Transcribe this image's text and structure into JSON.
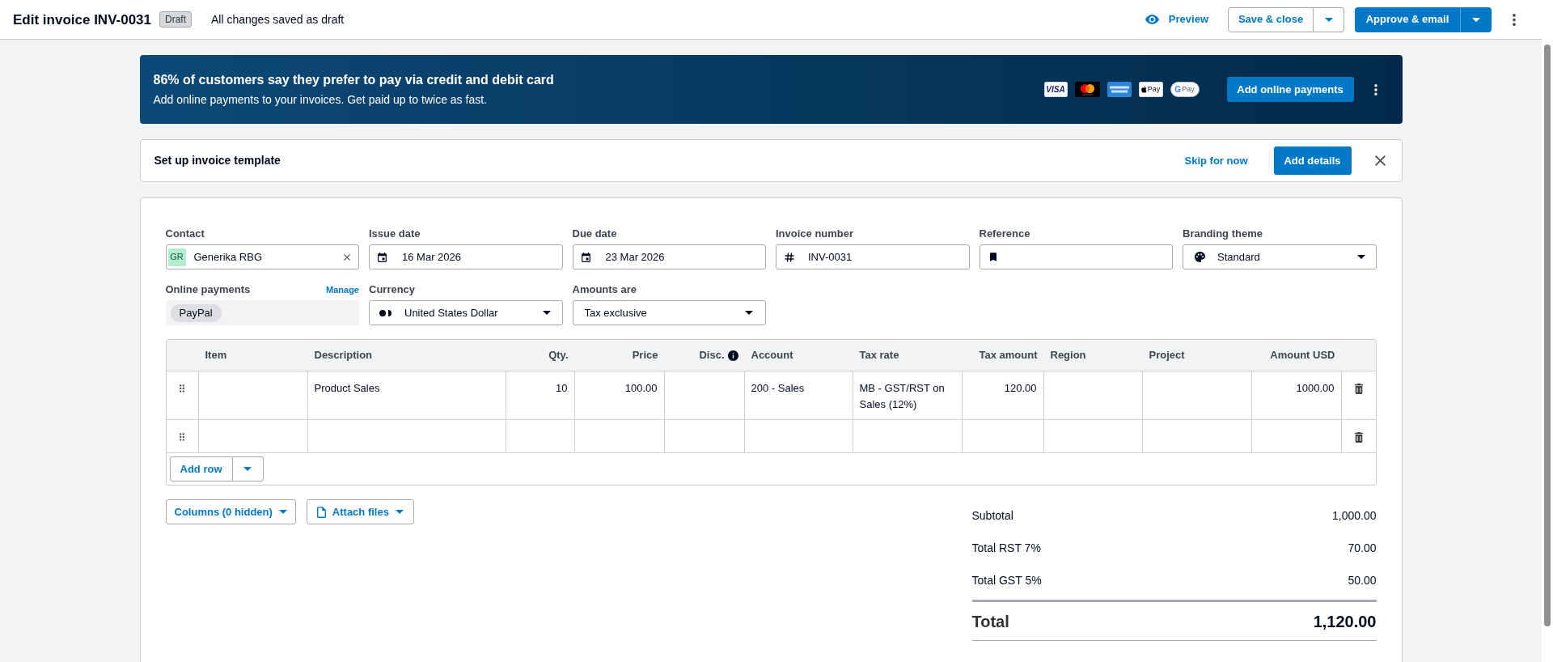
{
  "header": {
    "title": "Edit invoice INV-0031",
    "status": "Draft",
    "save_state": "All changes saved as draft",
    "preview": "Preview",
    "save": "Save & close",
    "approve": "Approve & email"
  },
  "promo_banner": {
    "title": "86% of customers say they prefer to pay via credit and debit card",
    "text": "Add online payments to your invoices. Get paid up to twice as fast.",
    "payment_logos": [
      {
        "kind": "visa",
        "label": "VISA"
      },
      {
        "kind": "mastercard"
      },
      {
        "kind": "amex"
      },
      {
        "kind": "applepay",
        "label": "Pay"
      },
      {
        "kind": "gpay",
        "mark": "G",
        "label": "Pay"
      }
    ],
    "button": "Add online payments"
  },
  "template_bar": {
    "title": "Set up invoice template",
    "link": "Skip for now",
    "button": "Add details"
  },
  "fields": [
    {
      "kind": "contact",
      "label": "Contact",
      "initials": "GR",
      "value": "Generika RBG"
    },
    {
      "kind": "date",
      "label": "Issue date",
      "value": "16 Mar 2026"
    },
    {
      "kind": "date",
      "label": "Due date",
      "value": "23 Mar 2026"
    },
    {
      "kind": "invoice_number",
      "label": "Invoice number",
      "value": "INV-0031"
    },
    {
      "kind": "reference",
      "label": "Reference"
    },
    {
      "kind": "theme",
      "label": "Branding theme",
      "value": "Standard"
    },
    {
      "kind": "payments",
      "label": "Online payments",
      "link": "Manage",
      "chips": [
        "PayPal"
      ]
    },
    {
      "kind": "currency",
      "label": "Currency",
      "value": "United States Dollar"
    },
    {
      "kind": "select",
      "label": "Amounts are",
      "value": "Tax exclusive"
    }
  ],
  "line_items": {
    "columns": [
      {
        "label": "Item",
        "kind": "text",
        "info": false
      },
      {
        "label": "Description",
        "kind": "text",
        "info": false
      },
      {
        "label": "Qty.",
        "kind": "number",
        "info": false
      },
      {
        "label": "Price",
        "kind": "number",
        "info": false
      },
      {
        "label": "Disc.",
        "kind": "number",
        "info": true
      },
      {
        "label": "Account",
        "kind": "text",
        "info": false
      },
      {
        "label": "Tax rate",
        "kind": "text",
        "info": false
      },
      {
        "label": "Tax amount",
        "kind": "number",
        "info": false
      },
      {
        "label": "Region",
        "kind": "text",
        "info": false
      },
      {
        "label": "Project",
        "kind": "text",
        "info": false
      },
      {
        "label": "Amount USD",
        "kind": "number",
        "info": false
      }
    ],
    "rows": [
      {
        "kind": "item",
        "cells": [
          null,
          "Product Sales",
          "10",
          "100.00",
          null,
          "200 - Sales",
          "MB - GST/RST on Sales (12%)",
          "120.00",
          null,
          null,
          "1000.00"
        ]
      },
      {
        "kind": "blank"
      }
    ],
    "add_row": "Add row"
  },
  "footer_buttons": {
    "columns": "Columns (0 hidden)",
    "attach": "Attach files"
  },
  "totals": [
    {
      "kind": "line",
      "label": "Subtotal",
      "value": "1,000.00"
    },
    {
      "kind": "line",
      "label": "Total RST 7%",
      "value": "70.00"
    },
    {
      "kind": "line",
      "label": "Total GST 5%",
      "value": "50.00"
    },
    {
      "kind": "grand",
      "label": "Total",
      "value": "1,120.00"
    }
  ]
}
